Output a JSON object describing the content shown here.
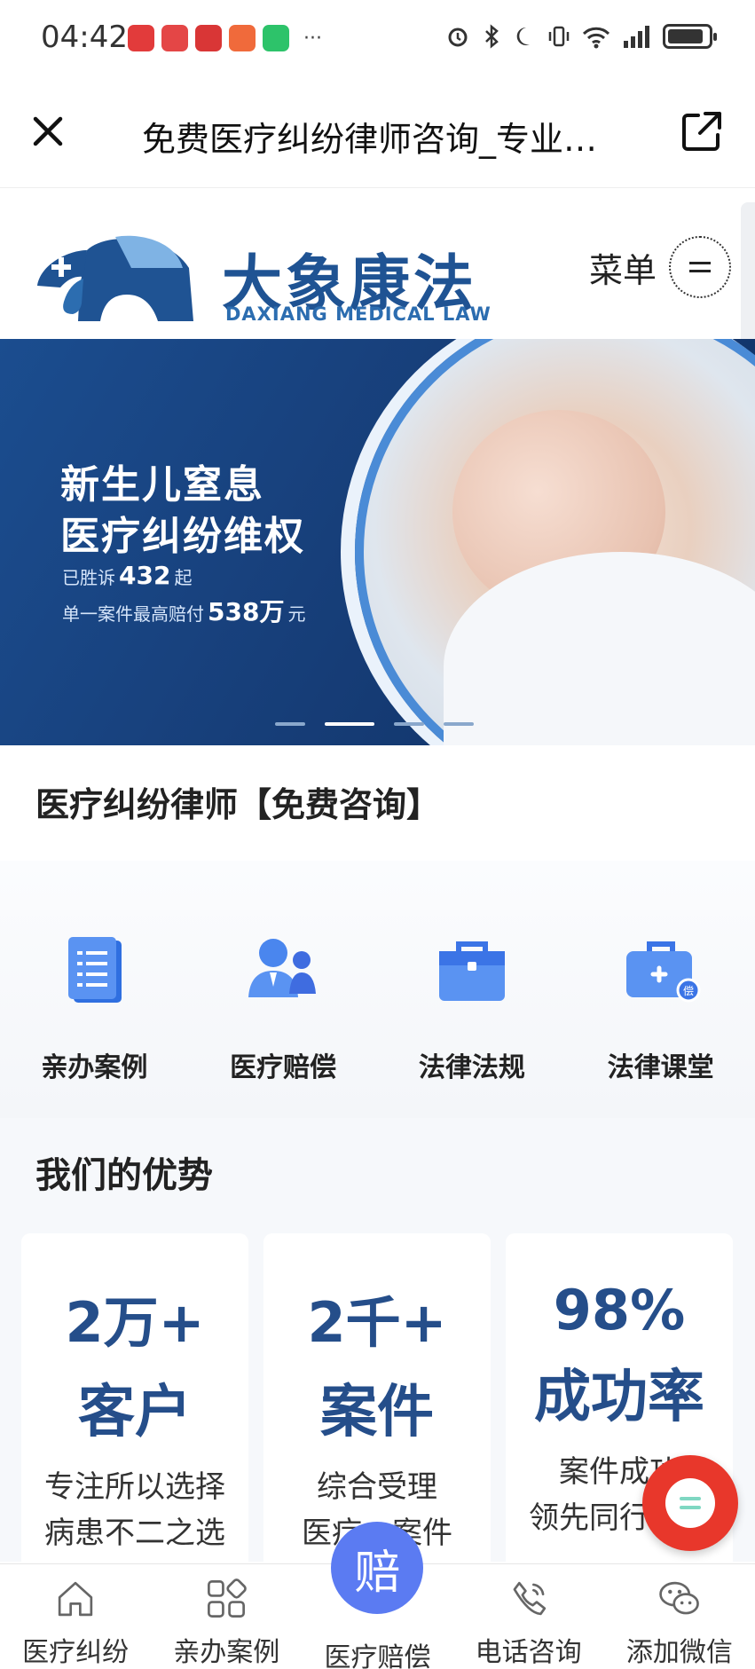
{
  "status_bar": {
    "time": "04:42",
    "overflow": "···",
    "app_icons": [
      {
        "name": "red-app-icon",
        "color": "#e23b3b"
      },
      {
        "name": "huawei-app-icon",
        "color": "#e23b3b"
      },
      {
        "name": "red-app-icon-2",
        "color": "#e23b3b"
      },
      {
        "name": "clown-app-icon",
        "color": "#f06a3b"
      },
      {
        "name": "wechat-app-icon",
        "color": "#2dc36a"
      }
    ],
    "battery_level": 0.9
  },
  "browser": {
    "title": "免费医疗纠纷律师咨询_专业…"
  },
  "site_header": {
    "brand_cn": "大象康法",
    "brand_en": "DAXIANG MEDICAL LAW",
    "menu_label": "菜单",
    "brand_color": "#1f5393"
  },
  "banner": {
    "headline_1": "新生儿窒息",
    "headline_2": "医疗纠纷维权",
    "stat1_prefix": "已胜诉",
    "stat1_value": "432",
    "stat1_suffix": "起",
    "stat2_prefix": "单一案件最高赔付",
    "stat2_value": "538万",
    "stat2_suffix": "元",
    "active_slide": 2,
    "slide_count": 4
  },
  "section_consult": {
    "title": "医疗纠纷律师【免费咨询】"
  },
  "quick_nav": [
    {
      "label": "亲办案例",
      "icon": "document-icon"
    },
    {
      "label": "医疗赔偿",
      "icon": "lawyer-icon"
    },
    {
      "label": "法律法规",
      "icon": "briefcase-icon"
    },
    {
      "label": "法律课堂",
      "icon": "medical-kit-icon"
    }
  ],
  "advantages": {
    "title": "我们的优势",
    "cards": [
      {
        "number": "2万+",
        "unit": "客户",
        "desc_1": "专注所以选择",
        "desc_2": "病患不二之选"
      },
      {
        "number": "2千+",
        "unit": "案件",
        "desc_1": "综合受理",
        "desc_2": "医疗…案件"
      },
      {
        "number": "98%",
        "unit": "成功率",
        "desc_1": "案件成功",
        "desc_2": "领先同行胜率"
      }
    ]
  },
  "bottom_nav": [
    {
      "label": "医疗纠纷",
      "icon": "home-icon"
    },
    {
      "label": "亲办案例",
      "icon": "grid-icon"
    },
    {
      "label": "医疗赔偿",
      "icon": "compensation-badge",
      "badge": "赔"
    },
    {
      "label": "电话咨询",
      "icon": "phone-icon"
    },
    {
      "label": "添加微信",
      "icon": "wechat-icon"
    }
  ]
}
